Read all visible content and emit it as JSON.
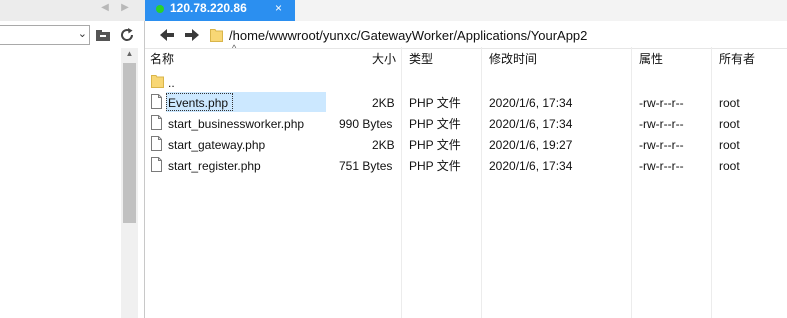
{
  "tab": {
    "title": "120.78.220.86",
    "close": "×"
  },
  "left_nav": {
    "back_arrow": "◀",
    "forward_arrow": "▶",
    "dropdown": "⌄"
  },
  "address": {
    "path": "/home/wwwroot/yunxc/GatewayWorker/Applications/YourApp2"
  },
  "columns": {
    "name": "名称",
    "size": "大小",
    "type": "类型",
    "modified": "修改时间",
    "attributes": "属性",
    "owner": "所有者"
  },
  "files": [
    {
      "name": "..",
      "size": "",
      "type": "",
      "modified": "",
      "attributes": "",
      "owner": "",
      "icon": "folder-icon",
      "selected": false
    },
    {
      "name": "Events.php",
      "size": "2KB",
      "type": "PHP 文件",
      "modified": "2020/1/6, 17:34",
      "attributes": "-rw-r--r--",
      "owner": "root",
      "icon": "file-icon",
      "selected": true
    },
    {
      "name": "start_businessworker.php",
      "size": "990 Bytes",
      "type": "PHP 文件",
      "modified": "2020/1/6, 17:34",
      "attributes": "-rw-r--r--",
      "owner": "root",
      "icon": "file-icon",
      "selected": false
    },
    {
      "name": "start_gateway.php",
      "size": "2KB",
      "type": "PHP 文件",
      "modified": "2020/1/6, 19:27",
      "attributes": "-rw-r--r--",
      "owner": "root",
      "icon": "file-icon",
      "selected": false
    },
    {
      "name": "start_register.php",
      "size": "751 Bytes",
      "type": "PHP 文件",
      "modified": "2020/1/6, 17:34",
      "attributes": "-rw-r--r--",
      "owner": "root",
      "icon": "file-icon",
      "selected": false
    }
  ],
  "colors": {
    "tab_active": "#2b8ff0",
    "connected_dot": "#29d229",
    "selection": "#cce8ff",
    "folder": "#f8d775"
  }
}
